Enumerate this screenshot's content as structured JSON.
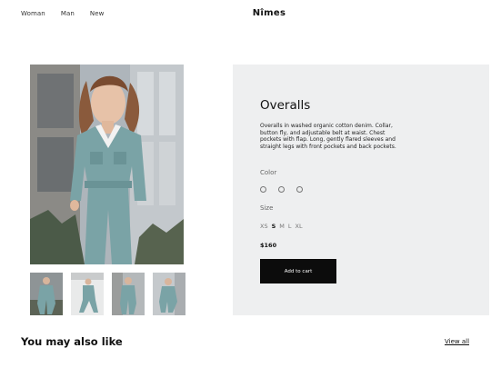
{
  "nav": {
    "links": [
      "Woman",
      "Man",
      "New"
    ],
    "brand": "Nîmes"
  },
  "product": {
    "title": "Overalls",
    "description": "Overalls in washed organic cotton denim. Collar, button fly, and adjustable belt at waist. Chest pockets with flap. Long, gently flared sleeves and straight legs with front pockets and back pockets.",
    "color_label": "Color",
    "size_label": "Size",
    "sizes": [
      "XS",
      "S",
      "M",
      "L",
      "XL"
    ],
    "selected_size": "S",
    "price": "$160",
    "add_to_cart": "Add to cart",
    "swatch_count": 3
  },
  "recommendations": {
    "title": "You may also like",
    "view_all": "View all"
  },
  "colors": {
    "panel_bg": "#eeeff0",
    "button_bg": "#0c0c0c",
    "denim": "#7aa3a6"
  }
}
